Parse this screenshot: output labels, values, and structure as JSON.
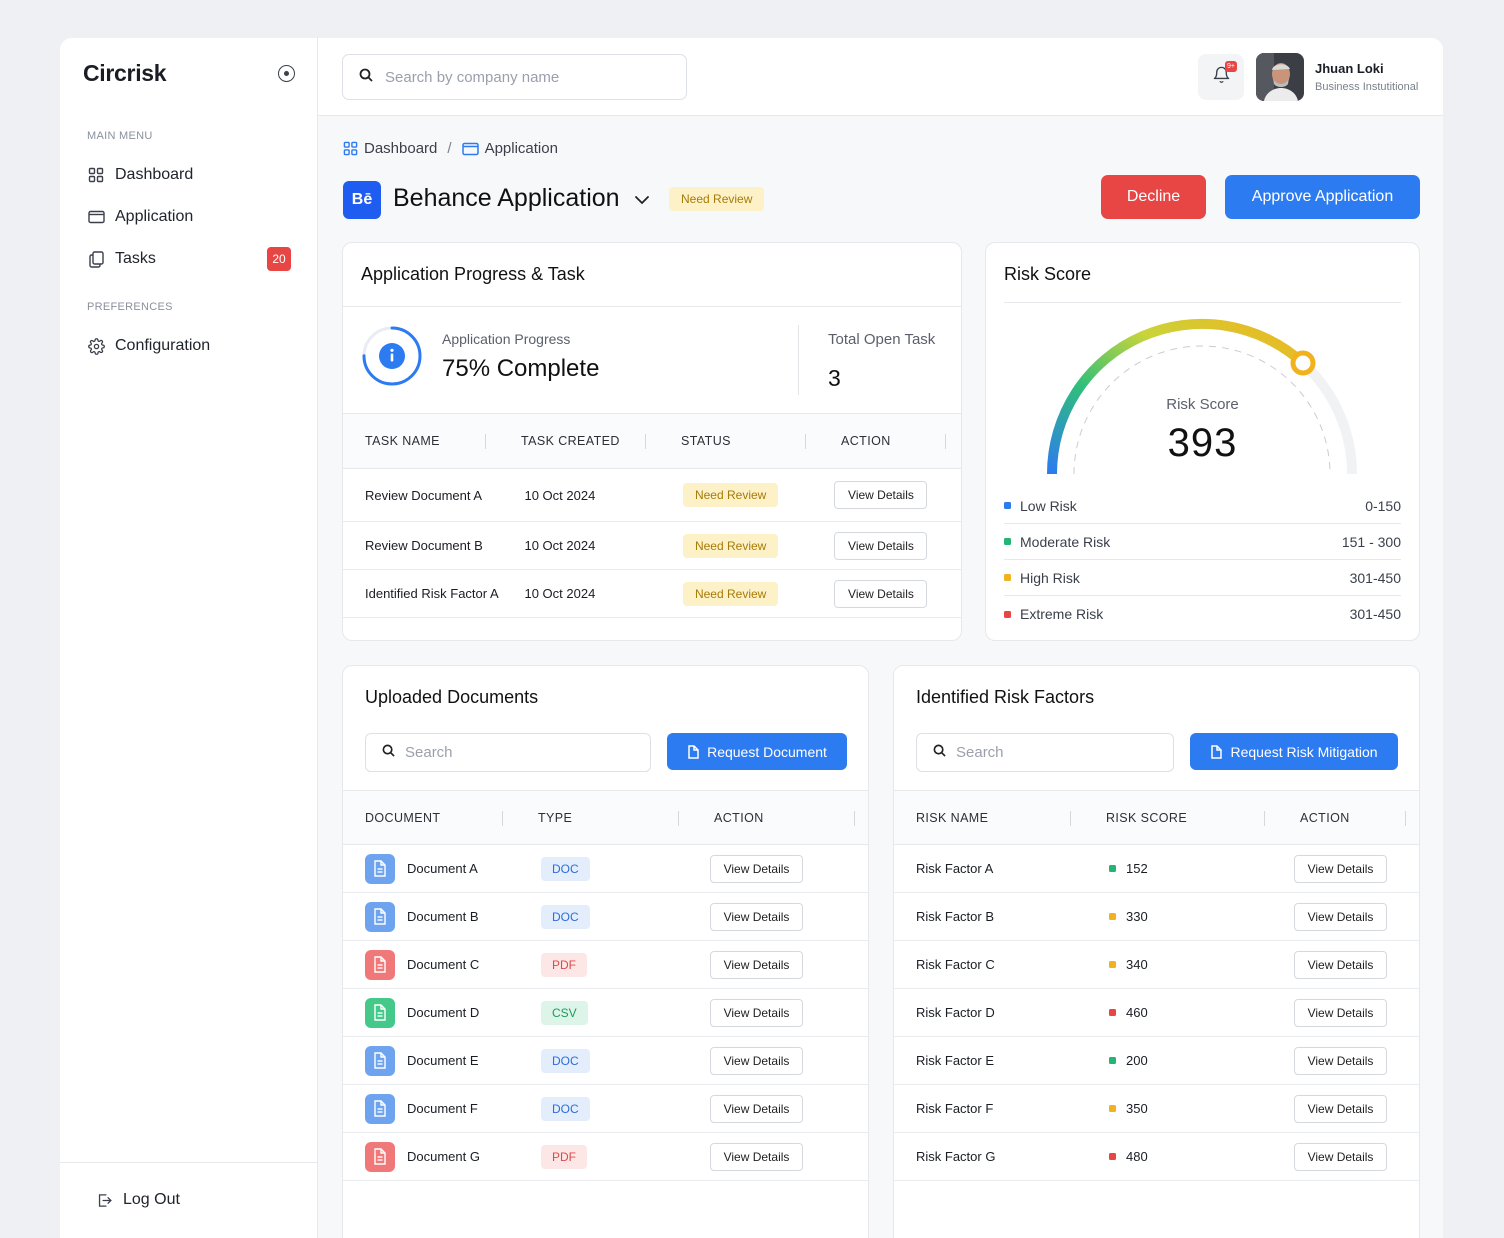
{
  "brand": "Circrisk",
  "sidebar": {
    "main_menu_label": "MAIN MENU",
    "preferences_label": "PREFERENCES",
    "items": [
      {
        "label": "Dashboard",
        "icon": "grid-icon"
      },
      {
        "label": "Application",
        "icon": "window-icon"
      },
      {
        "label": "Tasks",
        "icon": "copy-icon",
        "badge": "20"
      },
      {
        "label": "Configuration",
        "icon": "gear-icon"
      }
    ],
    "logout": "Log Out"
  },
  "topbar": {
    "search_placeholder": "Search by company name",
    "notification_badge": "9+",
    "user_name": "Jhuan Loki",
    "user_role": "Business Instutitional"
  },
  "breadcrumb": {
    "items": [
      "Dashboard",
      "Application"
    ],
    "separator": "/"
  },
  "application": {
    "logo_text": "Bē",
    "title": "Behance Application",
    "status": "Need Review",
    "decline_label": "Decline",
    "approve_label": "Approve Application"
  },
  "progress": {
    "title": "Application Progress & Task",
    "progress_label": "Application Progress",
    "progress_value": "75% Complete",
    "progress_fraction": 0.75,
    "open_task_label": "Total Open Task",
    "open_task_value": "3",
    "columns": [
      "TASK NAME",
      "TASK CREATED",
      "STATUS",
      "ACTION"
    ],
    "rows": [
      {
        "name": "Review Document A",
        "created": "10 Oct 2024",
        "status": "Need Review",
        "action": "View Details"
      },
      {
        "name": "Review Document B",
        "created": "10 Oct 2024",
        "status": "Need Review",
        "action": "View Details"
      },
      {
        "name": "Identified Risk Factor A",
        "created": "10 Oct 2024",
        "status": "Need Review",
        "action": "View Details"
      }
    ]
  },
  "risk_score": {
    "title": "Risk Score",
    "gauge_label": "Risk Score",
    "value": "393",
    "legend": [
      {
        "label": "Low Risk",
        "range": "0-150",
        "color": "#2d7bf0"
      },
      {
        "label": "Moderate Risk",
        "range": "151 - 300",
        "color": "#22b573"
      },
      {
        "label": "High Risk",
        "range": "301-450",
        "color": "#f2b21d"
      },
      {
        "label": "Extreme Risk",
        "range": "301-450",
        "color": "#e84545"
      }
    ]
  },
  "documents": {
    "title": "Uploaded Documents",
    "search_placeholder": "Search",
    "request_label": "Request Document",
    "columns": [
      "DOCUMENT",
      "TYPE",
      "ACTION"
    ],
    "rows": [
      {
        "name": "Document A",
        "type": "DOC",
        "action": "View Details"
      },
      {
        "name": "Document B",
        "type": "DOC",
        "action": "View Details"
      },
      {
        "name": "Document C",
        "type": "PDF",
        "action": "View Details"
      },
      {
        "name": "Document D",
        "type": "CSV",
        "action": "View Details"
      },
      {
        "name": "Document E",
        "type": "DOC",
        "action": "View Details"
      },
      {
        "name": "Document F",
        "type": "DOC",
        "action": "View Details"
      },
      {
        "name": "Document G",
        "type": "PDF",
        "action": "View Details"
      }
    ]
  },
  "risk_factors": {
    "title": "Identified Risk Factors",
    "search_placeholder": "Search",
    "request_label": "Request Risk Mitigation",
    "columns": [
      "RISK NAME",
      "RISK SCORE",
      "ACTION"
    ],
    "rows": [
      {
        "name": "Risk Factor A",
        "score": "152",
        "level": "moderate",
        "action": "View Details"
      },
      {
        "name": "Risk Factor B",
        "score": "330",
        "level": "high",
        "action": "View Details"
      },
      {
        "name": "Risk Factor C",
        "score": "340",
        "level": "high",
        "action": "View Details"
      },
      {
        "name": "Risk Factor D",
        "score": "460",
        "level": "extreme",
        "action": "View Details"
      },
      {
        "name": "Risk Factor E",
        "score": "200",
        "level": "moderate",
        "action": "View Details"
      },
      {
        "name": "Risk Factor F",
        "score": "350",
        "level": "high",
        "action": "View Details"
      },
      {
        "name": "Risk Factor G",
        "score": "480",
        "level": "extreme",
        "action": "View Details"
      }
    ]
  },
  "colors": {
    "accent": "#2d7bf0",
    "danger": "#e84545",
    "warning_bg": "#fdf1c8",
    "warning_text": "#a77b07",
    "moderate": "#22b573",
    "high": "#f2b21d",
    "extreme": "#e84545"
  }
}
